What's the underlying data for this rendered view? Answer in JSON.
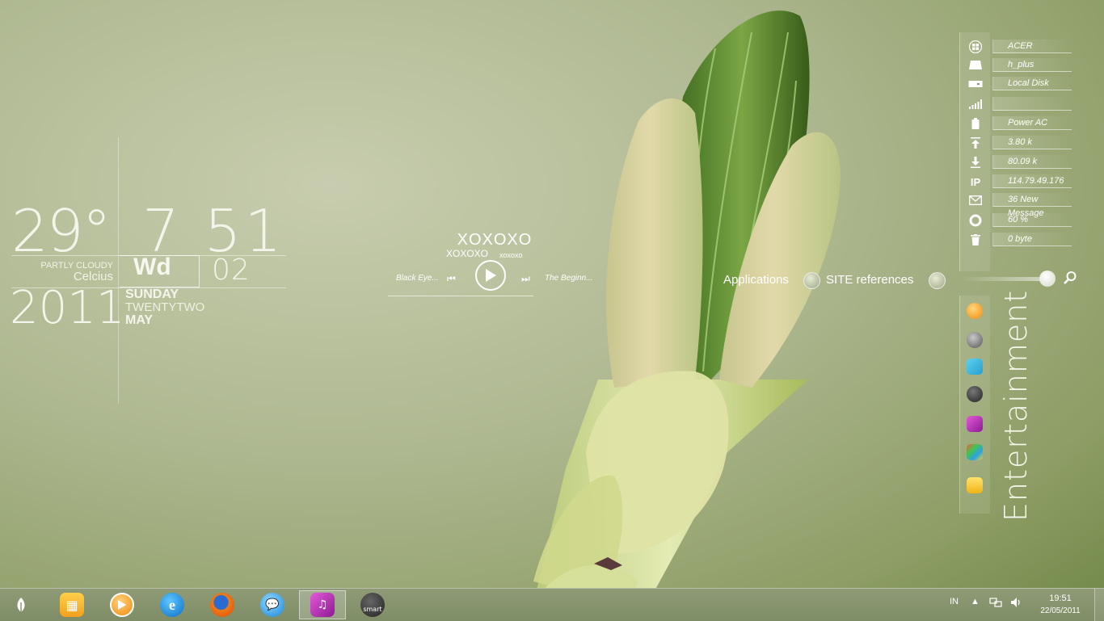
{
  "weather": {
    "temp": "29°",
    "condition": "PARTLY CLOUDY",
    "unit": "Celcius"
  },
  "clock": {
    "time": "7 51",
    "weekday_abbr": "Wd",
    "day_num": "02",
    "year": "2011",
    "weekday": "SUNDAY",
    "day_words": "TWENTYTWO",
    "month": "MAY"
  },
  "media": {
    "title": "XOXOXO",
    "artist": "XOXOXO",
    "album": "xoxoxo",
    "prev_track": "Black Eye...",
    "next_track": "The Beginn..."
  },
  "launcher": {
    "applications": "Applications",
    "site_references": "SITE references",
    "dock_title": "Entertainment"
  },
  "sysinfo": [
    {
      "icon": "windows-logo-icon",
      "value": "ACER"
    },
    {
      "icon": "drive-icon",
      "value": "h_plus"
    },
    {
      "icon": "local-disk-icon",
      "value": "Local Disk"
    },
    {
      "icon": "signal-bars-icon",
      "value": ""
    },
    {
      "icon": "battery-icon",
      "value": "Power AC"
    },
    {
      "icon": "upload-arrow-icon",
      "value": "3.80 k"
    },
    {
      "icon": "download-arrow-icon",
      "value": "80.09 k"
    },
    {
      "icon": "ip-icon",
      "value": "114.79.49.176",
      "label": "IP"
    },
    {
      "icon": "mail-icon",
      "value": "36 New Message"
    },
    {
      "icon": "cpu-ring-icon",
      "value": "60 %"
    },
    {
      "icon": "recycle-bin-icon",
      "value": "0 byte"
    }
  ],
  "dock_icons": [
    "media-player-icon",
    "settings-orb-icon",
    "gallery-icon",
    "eye-icon",
    "music-icon",
    "windows-tiles-icon",
    "notes-icon"
  ],
  "taskbar": {
    "start_icon": "leaf-start-icon",
    "apps": [
      "explorer-icon",
      "media-player-icon",
      "internet-explorer-icon",
      "firefox-icon",
      "messenger-icon",
      "music-icon",
      "smart-icon"
    ],
    "smart_label": "smart",
    "language": "IN",
    "time": "19:51",
    "date": "22/05/2011"
  },
  "colors": {
    "accent": "#f4f5ea",
    "taskbar": "#8a976f"
  }
}
